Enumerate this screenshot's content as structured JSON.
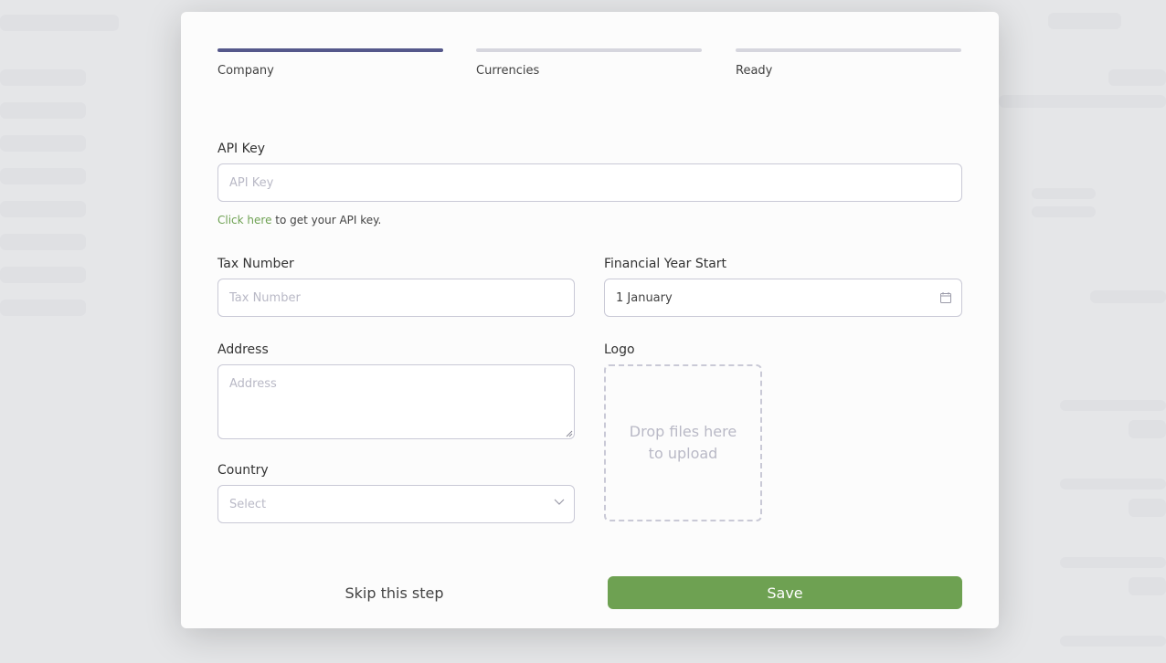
{
  "steps": [
    {
      "label": "Company",
      "active": true
    },
    {
      "label": "Currencies",
      "active": false
    },
    {
      "label": "Ready",
      "active": false
    }
  ],
  "form": {
    "api_key": {
      "label": "API Key",
      "placeholder": "API Key",
      "value": ""
    },
    "api_hint": {
      "link": "Click here",
      "text": " to get your API key."
    },
    "tax_number": {
      "label": "Tax Number",
      "placeholder": "Tax Number",
      "value": ""
    },
    "financial_year_start": {
      "label": "Financial Year Start",
      "value": "1 January"
    },
    "address": {
      "label": "Address",
      "placeholder": "Address",
      "value": ""
    },
    "logo": {
      "label": "Logo",
      "dropzone_text": "Drop files here to upload"
    },
    "country": {
      "label": "Country",
      "placeholder": "Select"
    }
  },
  "actions": {
    "skip_label": "Skip this step",
    "save_label": "Save"
  },
  "colors": {
    "accent": "#55588b",
    "primary": "#6ea152"
  },
  "icons": {
    "calendar": "calendar-icon",
    "dropdown": "chevron-down-icon"
  }
}
